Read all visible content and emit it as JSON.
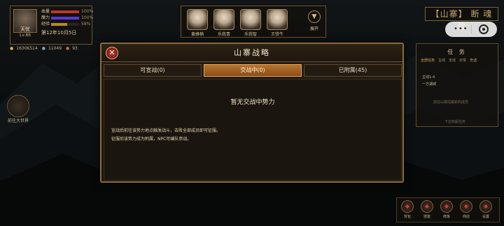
{
  "player": {
    "name": "天忧",
    "level": "Lv.86",
    "stats": [
      {
        "label": "血量",
        "percent": 100,
        "pct_text": "100%",
        "color": "#c0352c"
      },
      {
        "label": "魔力",
        "percent": 100,
        "pct_text": "100%",
        "color": "#5a3ad0"
      },
      {
        "label": "经验",
        "percent": 58,
        "pct_text": "58%",
        "color": "#b58a2a"
      }
    ],
    "date": "第12年10月5日",
    "resources": [
      "16306514",
      "11049",
      "93"
    ]
  },
  "npcs": [
    {
      "name": "黄蜂楠"
    },
    {
      "name": "乐我青"
    },
    {
      "name": "乐我智"
    },
    {
      "name": "王铁牛"
    }
  ],
  "expand_label": "展开",
  "top_right_title": "【山寨】 断 魂 营",
  "task_panel": {
    "title": "任 务",
    "tabs": [
      "全部任务",
      "主线",
      "支线",
      "日常",
      "奇遇"
    ],
    "line1": "主线1-4",
    "line2": "一方湖城",
    "line3": "前往山寨招募新的成员",
    "line4": "下拉收起任务"
  },
  "left_button_label": "前往大世界",
  "tools": [
    {
      "label": "背包",
      "icon": "bag-icon"
    },
    {
      "label": "技能",
      "icon": "skill-icon"
    },
    {
      "label": "修炼",
      "icon": "cultivate-icon"
    },
    {
      "label": "商店",
      "icon": "shop-icon"
    },
    {
      "label": "设置",
      "icon": "settings-icon"
    }
  ],
  "modal": {
    "title": "山寨战略",
    "close_glyph": "✕",
    "tabs": [
      {
        "label": "可宣战(0)",
        "active": false
      },
      {
        "label": "交战中(0)",
        "active": true
      },
      {
        "label": "已附属(45)",
        "active": false
      }
    ],
    "empty_text": "暂无交战中势力",
    "notes": [
      "宣战后前往该势力地点触发战斗，击败全部成员即可征服。",
      "征服后该势力成为附属，NPC可编队参战。"
    ]
  }
}
